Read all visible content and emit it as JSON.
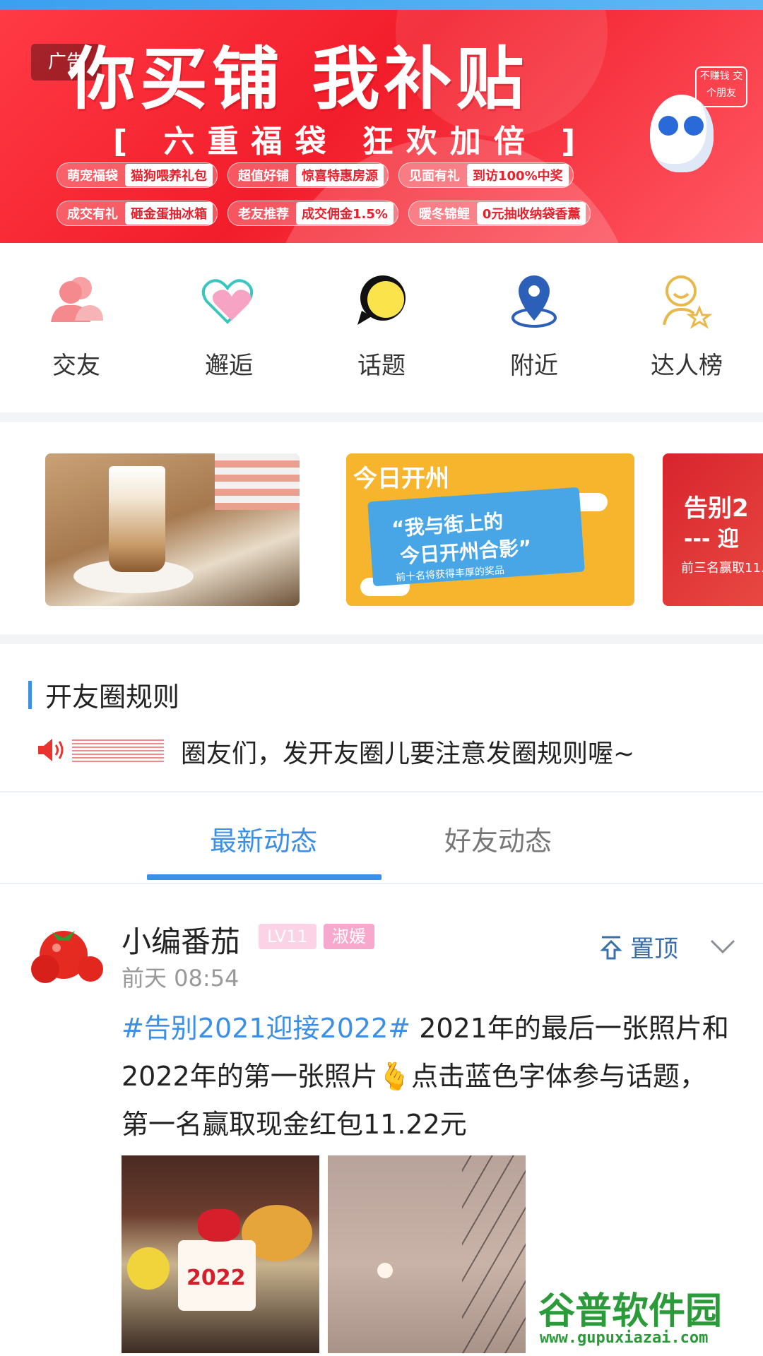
{
  "banner": {
    "ad_tag": "广告",
    "title": "你买铺 我补贴",
    "subtitle": "[ 六重福袋 狂欢加倍 ]",
    "brand_badge": "不赚钱 交个朋友",
    "promos_row1": [
      {
        "key": "萌宠福袋",
        "value": "猫狗喂养礼包"
      },
      {
        "key": "超值好铺",
        "value": "惊喜特惠房源"
      },
      {
        "key": "见面有礼",
        "value": "到访100%中奖"
      }
    ],
    "promos_row2": [
      {
        "key": "成交有礼",
        "value": "砸金蛋抽冰箱"
      },
      {
        "key": "老友推荐",
        "value": "成交佣金1.5%"
      },
      {
        "key": "暖冬锦鲤",
        "value": "0元抽收纳袋香薰"
      }
    ]
  },
  "quick_nav": [
    {
      "label": "交友",
      "icon": "people-icon"
    },
    {
      "label": "邂逅",
      "icon": "heart-icon"
    },
    {
      "label": "话题",
      "icon": "chat-bubble-icon"
    },
    {
      "label": "附近",
      "icon": "location-pin-icon"
    },
    {
      "label": "达人榜",
      "icon": "star-person-icon"
    }
  ],
  "carousel": {
    "card2_title": "今日开州",
    "card2_line1": "“我与街上的",
    "card2_line2": "今日开州合影”",
    "card2_line3": "前十名将获得丰厚的奖品",
    "card3_line1": "告别2",
    "card3_line2": "--- 迎",
    "card3_line3": "前三名赢取11."
  },
  "rules": {
    "title": "开友圈规则",
    "notice": "圈友们，发开友圈儿要注意发圈规则喔~"
  },
  "tabs": {
    "latest": "最新动态",
    "friends": "好友动态"
  },
  "post": {
    "username": "小编番茄",
    "level": "LV11",
    "tag": "淑媛",
    "time": "前天 08:54",
    "pin_label": "置顶",
    "hashtag": "#告别2021迎接2022#",
    "text": " 2021年的最后一张照片和2022年的第一张照片🫰点击蓝色字体参与话题，第一名赢取现金红包11.22元",
    "photo1_text": "2022"
  },
  "watermark": {
    "name": "谷普软件园",
    "url": "www.gupuxiazai.com"
  },
  "colors": {
    "accent": "#3b8fe6",
    "banner_red": "#f21d2a"
  }
}
